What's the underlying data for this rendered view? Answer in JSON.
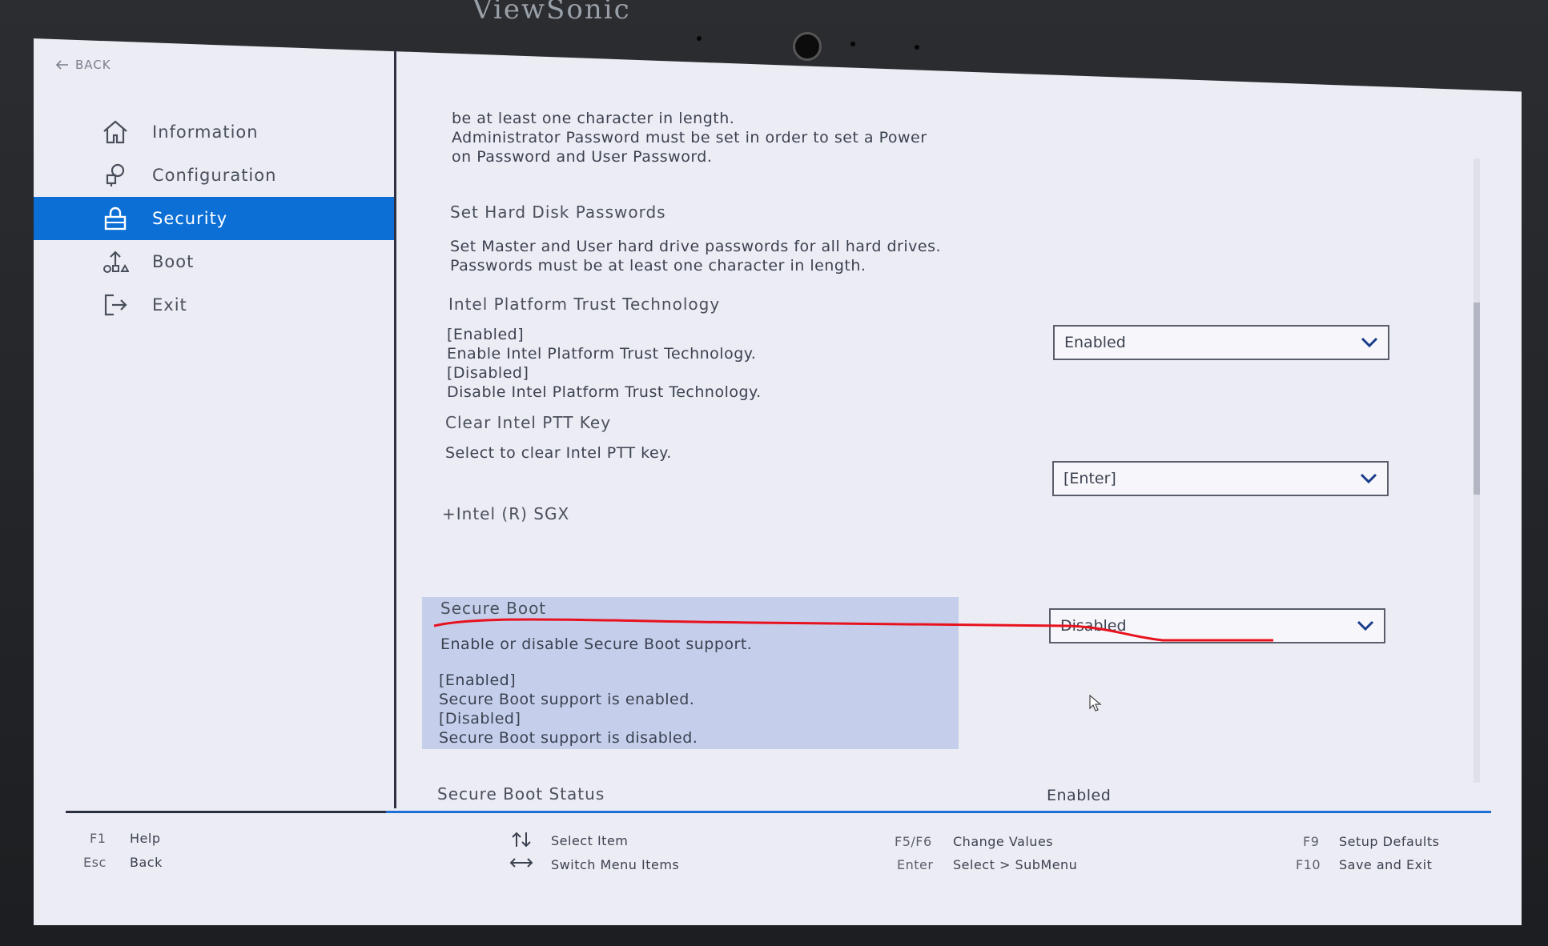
{
  "monitor": {
    "brand": "ViewSonic"
  },
  "nav": {
    "back_label": "BACK",
    "items": [
      {
        "label": "Information",
        "icon": "home-icon"
      },
      {
        "label": "Configuration",
        "icon": "configuration-icon"
      },
      {
        "label": "Security",
        "icon": "security-lock-icon",
        "active": true
      },
      {
        "label": "Boot",
        "icon": "boot-icon"
      },
      {
        "label": "Exit",
        "icon": "exit-icon"
      }
    ]
  },
  "content": {
    "top_desc": "be at least one character in length.\nAdministrator Password must be set in order to set a Power\non Password and User Password.",
    "hdd_title": "Set Hard Disk Passwords",
    "hdd_desc": "Set Master and User hard drive passwords for all hard drives.\nPasswords must be at least one character in length.",
    "ptt_title": "Intel Platform Trust Technology",
    "ptt_desc": "[Enabled]\nEnable Intel Platform Trust Technology.\n[Disabled]\nDisable Intel Platform Trust Technology.",
    "ptt_value": "Enabled",
    "clear_title": "Clear Intel PTT Key",
    "clear_desc": "Select to clear Intel PTT key.",
    "clear_value": "[Enter]",
    "sgx_title": "+Intel (R) SGX",
    "secure_boot_title": "Secure Boot",
    "secure_boot_desc": "Enable or disable Secure Boot support.",
    "secure_boot_options": "[Enabled]\nSecure Boot support is enabled.\n[Disabled]\nSecure Boot support is disabled.",
    "secure_boot_value": "Disabled",
    "status_title": "Secure Boot Status",
    "status_value": "Enabled"
  },
  "footer": {
    "f1_key": "F1",
    "f1_desc": "Help",
    "esc_key": "Esc",
    "esc_desc": "Back",
    "select_item": "Select Item",
    "switch_menu": "Switch Menu Items",
    "f5f6_key": "F5/F6",
    "f5f6_desc": "Change Values",
    "enter_key": "Enter",
    "enter_desc": "Select > SubMenu",
    "f9_key": "F9",
    "f9_desc": "Setup Defaults",
    "f10_key": "F10",
    "f10_desc": "Save and Exit"
  },
  "colors": {
    "accent": "#0b6fd6",
    "highlight": "#c5cfec",
    "annotation": "#e8121e"
  }
}
